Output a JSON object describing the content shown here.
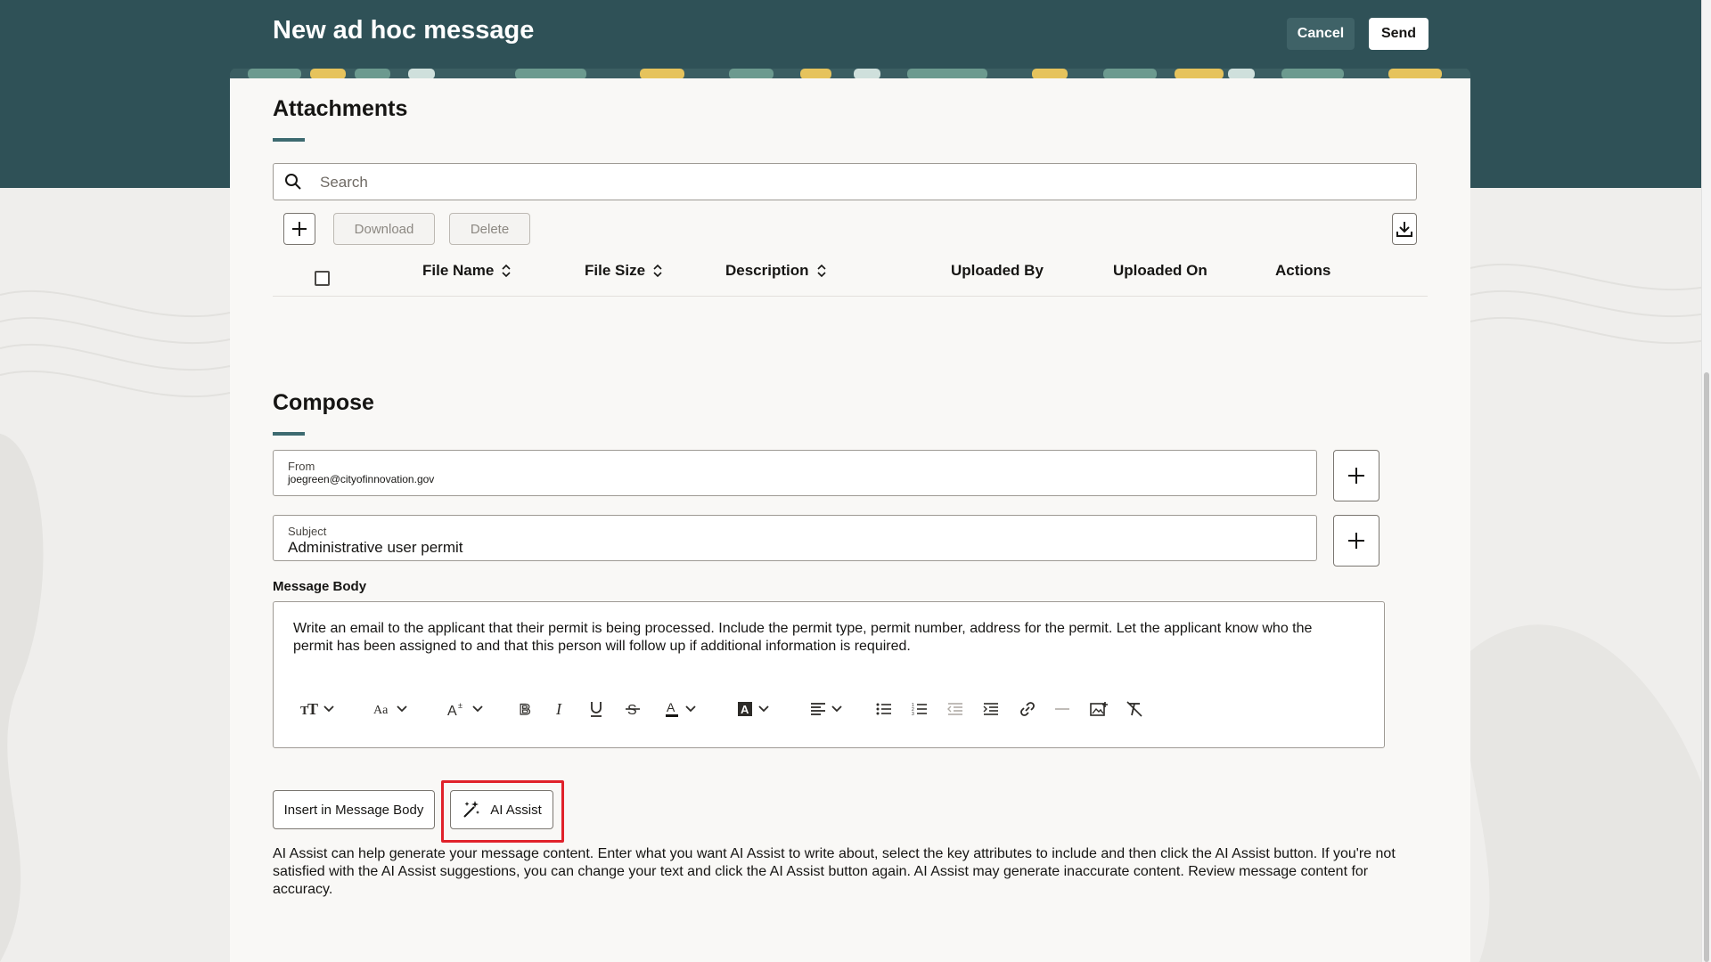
{
  "header": {
    "title": "New ad hoc message",
    "cancel_label": "Cancel",
    "send_label": "Send"
  },
  "attachments": {
    "title": "Attachments",
    "search_placeholder": "Search",
    "download_label": "Download",
    "delete_label": "Delete",
    "columns": [
      "File Name",
      "File Size",
      "Description",
      "Uploaded By",
      "Uploaded On",
      "Actions"
    ]
  },
  "compose": {
    "title": "Compose",
    "from_label": "From",
    "from_value": "joegreen@cityofinnovation.gov",
    "subject_label": "Subject",
    "subject_value": "Administrative user permit",
    "message_body_label": "Message Body",
    "message_body_text": "Write an email to the applicant that their permit is being processed. Include the permit type, permit number, address for the permit. Let the applicant know who the permit has been assigned to and that this person will follow up if additional information is required.",
    "insert_label": "Insert in Message Body",
    "ai_assist_label": "AI Assist",
    "help_text": "AI Assist can help generate your message content. Enter what you want AI Assist to write about, select the key attributes to include and then click the AI Assist button. If you're not satisfied with the AI Assist suggestions, you can change your text and click the AI Assist button again. AI Assist may generate inaccurate content. Review message content for accuracy."
  },
  "toolbar_icons": [
    "font-size-icon",
    "font-family-icon",
    "superscript-icon",
    "bold-icon",
    "italic-icon",
    "underline-icon",
    "strikethrough-icon",
    "text-color-icon",
    "highlight-color-icon",
    "align-icon",
    "bullet-list-icon",
    "numbered-list-icon",
    "outdent-icon",
    "indent-icon",
    "link-icon",
    "horizontal-rule-icon",
    "insert-image-icon",
    "clear-format-icon"
  ],
  "colors": {
    "header_bg": "#2f5157",
    "panel_bg": "#f9f8f6",
    "highlight_box": "#e0212a",
    "accent_underline": "#3d6a70"
  }
}
